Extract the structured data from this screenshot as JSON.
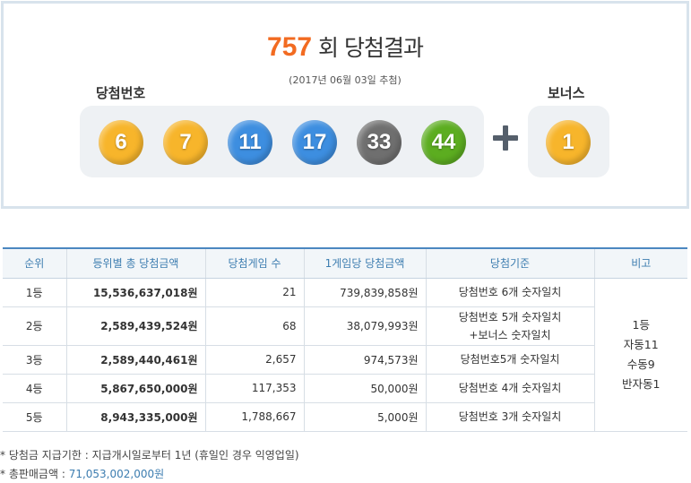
{
  "draw": {
    "round": "757",
    "title_suffix": "회 당첨결과",
    "date": "(2017년 06월 03일 추첨)",
    "win_label": "당첨번호",
    "bonus_label": "보너스",
    "numbers": [
      {
        "value": "6",
        "color": "#f7b52b"
      },
      {
        "value": "7",
        "color": "#f7b52b"
      },
      {
        "value": "11",
        "color": "#3d8ee0"
      },
      {
        "value": "17",
        "color": "#3d8ee0"
      },
      {
        "value": "33",
        "color": "#6f6f6f"
      },
      {
        "value": "44",
        "color": "#5cad20"
      }
    ],
    "bonus": {
      "value": "1",
      "color": "#f7b52b"
    }
  },
  "table": {
    "headers": [
      "순위",
      "등위별 총 당첨금액",
      "당첨게임 수",
      "1게임당 당첨금액",
      "당첨기준",
      "비고"
    ],
    "rows": [
      {
        "rank": "1등",
        "total": "15,536,637,018원",
        "count": "21",
        "per": "739,839,858원",
        "crit": [
          "당첨번호 6개 숫자일치"
        ]
      },
      {
        "rank": "2등",
        "total": "2,589,439,524원",
        "count": "68",
        "per": "38,079,993원",
        "crit": [
          "당첨번호 5개 숫자일치",
          "+보너스 숫자일치"
        ]
      },
      {
        "rank": "3등",
        "total": "2,589,440,461원",
        "count": "2,657",
        "per": "974,573원",
        "crit": [
          "당첨번호5개 숫자일치"
        ]
      },
      {
        "rank": "4등",
        "total": "5,867,650,000원",
        "count": "117,353",
        "per": "50,000원",
        "crit": [
          "당첨번호 4개 숫자일치"
        ]
      },
      {
        "rank": "5등",
        "total": "8,943,335,000원",
        "count": "1,788,667",
        "per": "5,000원",
        "crit": [
          "당첨번호 3개 숫자일치"
        ]
      }
    ],
    "note": [
      "1등",
      "자동11",
      "수동9",
      "반자동1"
    ]
  },
  "footer": {
    "deadline": "* 당첨금 지급기한 : 지급개시일로부터 1년 (휴일인 경우 익영업일)",
    "sales_label": "* 총판매금액 : ",
    "sales_value": "71,053,002,000원"
  },
  "colors": {
    "accent": "#f26b21",
    "header_text": "#3d7db0",
    "border": "#4b87c0"
  }
}
